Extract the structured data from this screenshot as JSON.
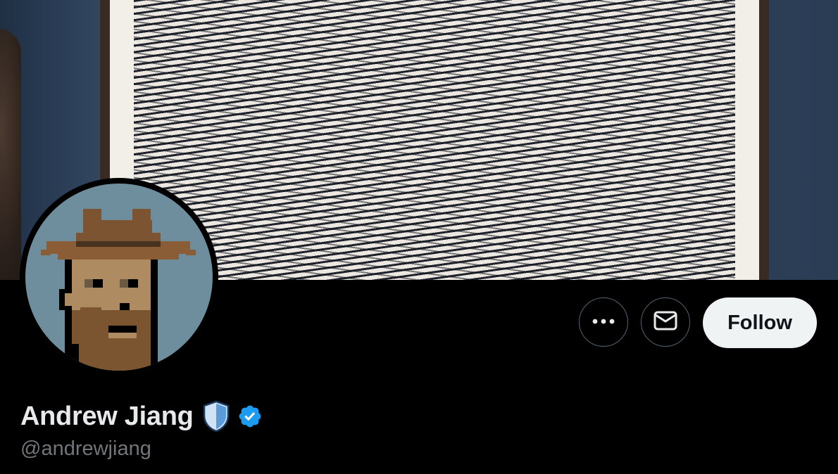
{
  "banner": {
    "description_icon": "banner-artwork-image"
  },
  "avatar": {
    "icon": "pixel-punk-avatar",
    "bg_color": "#6e8d9d"
  },
  "actions": {
    "more_icon": "more-horizontal-icon",
    "message_icon": "envelope-icon",
    "follow_label": "Follow"
  },
  "profile": {
    "display_name": "Andrew Jiang",
    "handle": "@andrewjiang",
    "badges": [
      "shield-icon",
      "verified-badge-icon"
    ]
  },
  "colors": {
    "background": "#000000",
    "name_text": "#e7e9ea",
    "handle_text": "#71767b",
    "follow_bg": "#eff3f4",
    "follow_text": "#0f1419",
    "verified_blue": "#1d9bf0",
    "outline_button_border": "#536471"
  }
}
